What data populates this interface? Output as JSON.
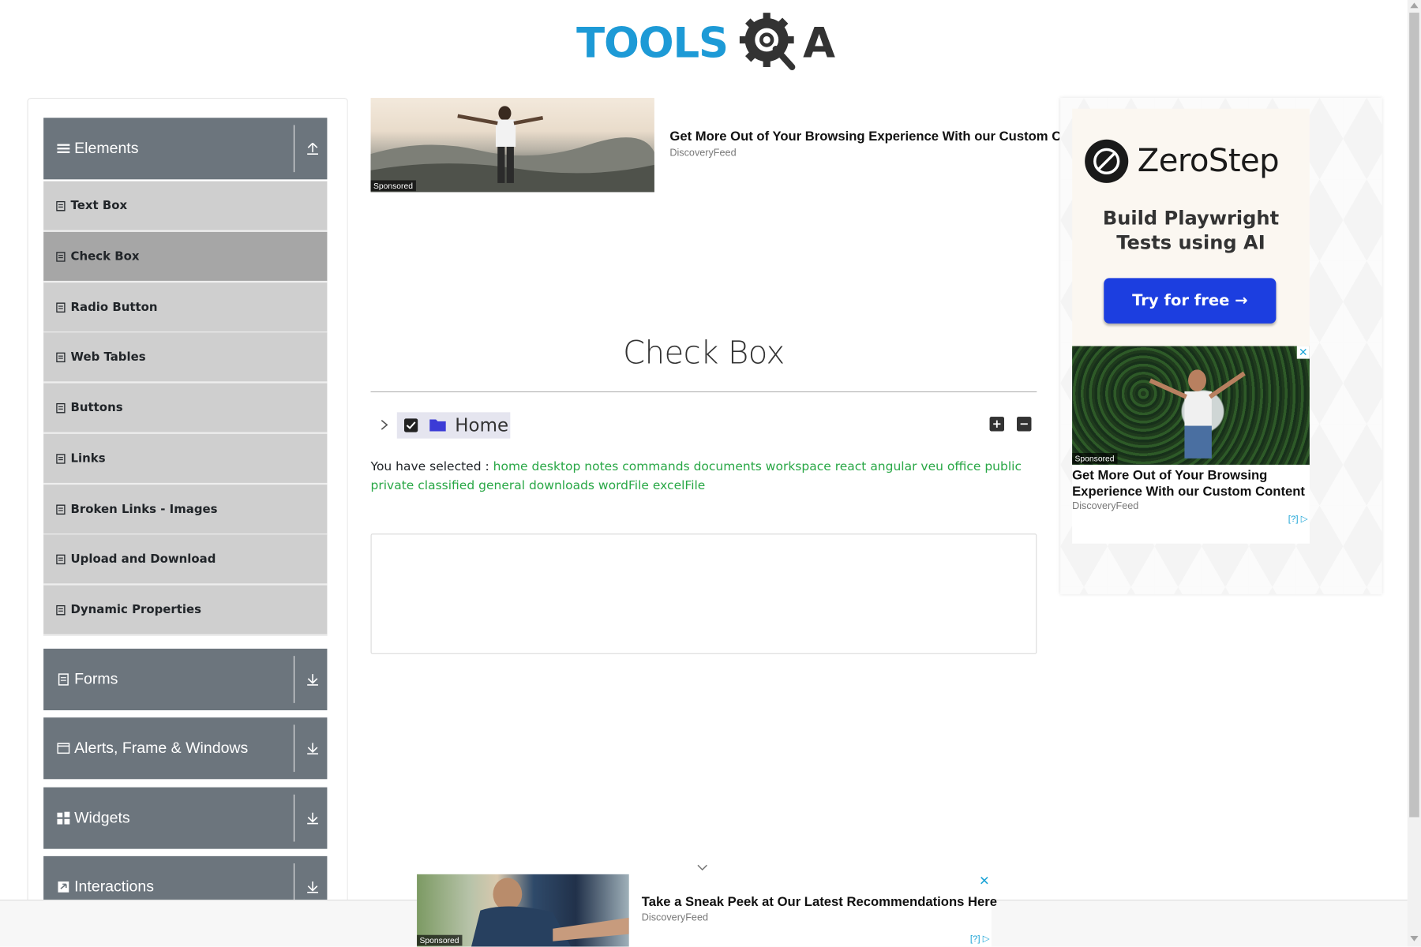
{
  "header": {
    "logo_text": "TOOLS",
    "logo_text_end": "A"
  },
  "sidebar": {
    "groups": [
      {
        "label": "Elements",
        "icon": "hamburger-icon",
        "expanded": true
      },
      {
        "label": "Forms",
        "icon": "document-icon",
        "expanded": false
      },
      {
        "label": "Alerts, Frame & Windows",
        "icon": "window-icon",
        "expanded": false
      },
      {
        "label": "Widgets",
        "icon": "grid-icon",
        "expanded": false
      },
      {
        "label": "Interactions",
        "icon": "interactions-icon",
        "expanded": false
      }
    ],
    "items": [
      {
        "label": "Text Box"
      },
      {
        "label": "Check Box",
        "active": true
      },
      {
        "label": "Radio Button"
      },
      {
        "label": "Web Tables"
      },
      {
        "label": "Buttons"
      },
      {
        "label": "Links"
      },
      {
        "label": "Broken Links - Images"
      },
      {
        "label": "Upload and Download"
      },
      {
        "label": "Dynamic Properties"
      }
    ]
  },
  "top_ad": {
    "sponsored": "Sponsored",
    "title": "Get More Out of Your Browsing Experience With our Custom Content",
    "source": "DiscoveryFeed"
  },
  "main": {
    "title": "Check Box",
    "tree": {
      "root_label": "Home",
      "checked": true
    },
    "result": {
      "prefix": "You have selected :",
      "selected": [
        "home",
        "desktop",
        "notes",
        "commands",
        "documents",
        "workspace",
        "react",
        "angular",
        "veu",
        "office",
        "public",
        "private",
        "classified",
        "general",
        "downloads",
        "wordFile",
        "excelFile"
      ]
    }
  },
  "right_ad": {
    "brand": "ZeroStep",
    "tagline": "Build Playwright Tests using AI",
    "cta": "Try for free →",
    "card": {
      "sponsored": "Sponsored",
      "title": "Get More Out of Your Browsing Experience With our Custom Content",
      "source": "DiscoveryFeed",
      "info": "[?]"
    }
  },
  "bottom_ad": {
    "sponsored": "Sponsored",
    "title": "Take a Sneak Peek at Our Latest Recommendations Here",
    "source": "DiscoveryFeed",
    "info": "[?]",
    "close": "✕"
  },
  "colors": {
    "logo_blue": "#1d9ad6",
    "sidebar_header": "#6c757d",
    "sidebar_item": "#cfcfcf",
    "sidebar_active": "#a6a6a6",
    "selected_text": "#28a745",
    "cta_blue": "#1c3ee0"
  }
}
